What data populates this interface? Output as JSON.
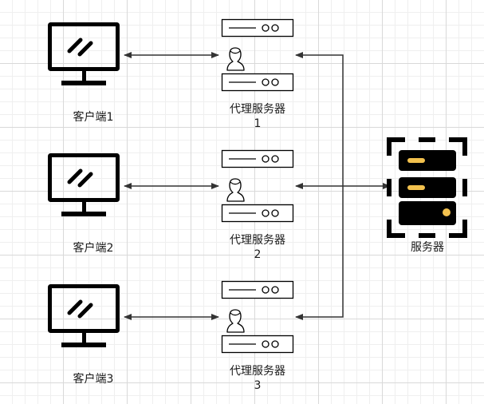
{
  "clients": [
    {
      "label": "客户端1"
    },
    {
      "label": "客户端2"
    },
    {
      "label": "客户端3"
    }
  ],
  "proxies": [
    {
      "label_line1": "代理服务器",
      "label_line2": "1"
    },
    {
      "label_line1": "代理服务器",
      "label_line2": "2"
    },
    {
      "label_line1": "代理服务器",
      "label_line2": "3"
    }
  ],
  "server": {
    "label": "服务器"
  },
  "colors": {
    "line": "#333333",
    "icon": "#000000",
    "server_accent": "#f2c14e"
  }
}
